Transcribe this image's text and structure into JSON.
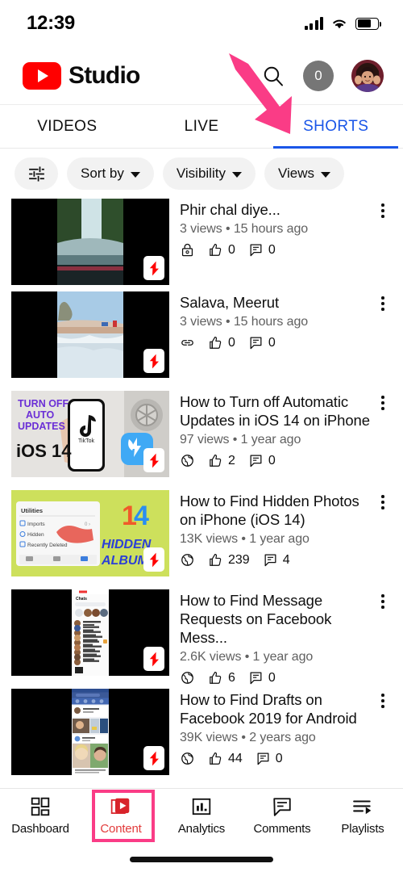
{
  "status_bar": {
    "time": "12:39",
    "signal_icon": "cellular-signal-icon",
    "wifi_icon": "wifi-icon",
    "battery_icon": "battery-icon"
  },
  "header": {
    "logo_icon": "youtube-logo-icon",
    "brand": "Studio",
    "search_icon": "search-icon",
    "notification_count": "0",
    "avatar_icon": "avatar"
  },
  "tabs": [
    {
      "label": "VIDEOS",
      "active": false
    },
    {
      "label": "LIVE",
      "active": false
    },
    {
      "label": "SHORTS",
      "active": true
    }
  ],
  "filters": {
    "tune_icon": "filter-tune-icon",
    "chips": [
      {
        "label": "Sort by"
      },
      {
        "label": "Visibility"
      },
      {
        "label": "Views"
      }
    ]
  },
  "colors": {
    "accent_blue": "#1a56e8",
    "youtube_red": "#ff0000",
    "annotation_pink": "#fa3c86",
    "nav_active_red": "#e23b3b",
    "secondary_text": "#606060",
    "chip_bg": "#f2f2f2"
  },
  "annotations": {
    "arrow_target": "SHORTS",
    "highlight_target": "Content"
  },
  "videos": [
    {
      "title": "Phir chal diye...",
      "stats": "3 views • 15 hours ago",
      "visibility_icon": "lock-icon",
      "likes": "0",
      "comments": "0",
      "badge_icon": "shorts-badge-icon"
    },
    {
      "title": "Salava, Meerut",
      "stats": "3 views • 15 hours ago",
      "visibility_icon": "link-icon",
      "likes": "0",
      "comments": "0",
      "badge_icon": "shorts-badge-icon"
    },
    {
      "title": "How to Turn off Automatic Updates in iOS 14 on iPhone",
      "stats": "97 views • 1 year ago",
      "visibility_icon": "globe-icon",
      "likes": "2",
      "comments": "0",
      "badge_icon": "shorts-badge-icon"
    },
    {
      "title": "How to Find Hidden Photos on iPhone (iOS 14)",
      "stats": "13K views • 1 year ago",
      "visibility_icon": "globe-icon",
      "likes": "239",
      "comments": "4",
      "badge_icon": "shorts-badge-icon"
    },
    {
      "title": "How to Find Message Requests on Facebook Mess...",
      "stats": "2.6K views • 1 year ago",
      "visibility_icon": "globe-icon",
      "likes": "6",
      "comments": "0",
      "badge_icon": "shorts-badge-icon"
    },
    {
      "title": "How to Find Drafts on Facebook 2019 for Android",
      "stats": "39K views • 2 years ago",
      "visibility_icon": "globe-icon",
      "likes": "44",
      "comments": "0",
      "badge_icon": "shorts-badge-icon"
    }
  ],
  "thumbnail_text": {
    "video3": [
      "TURN OFF",
      "AUTO",
      "UPDATES",
      "iOS 14",
      "TikTok"
    ],
    "video4": [
      "Utilities",
      "Imports",
      "Hidden",
      "Recently Deleted",
      "14",
      "HIDDEN",
      "ALBUM"
    ]
  },
  "bottom_nav": [
    {
      "label": "Dashboard",
      "icon": "dashboard-grid-icon",
      "active": false
    },
    {
      "label": "Content",
      "icon": "content-video-icon",
      "active": true
    },
    {
      "label": "Analytics",
      "icon": "analytics-bar-icon",
      "active": false
    },
    {
      "label": "Comments",
      "icon": "comments-bubble-icon",
      "active": false
    },
    {
      "label": "Playlists",
      "icon": "playlists-icon",
      "active": false
    }
  ]
}
